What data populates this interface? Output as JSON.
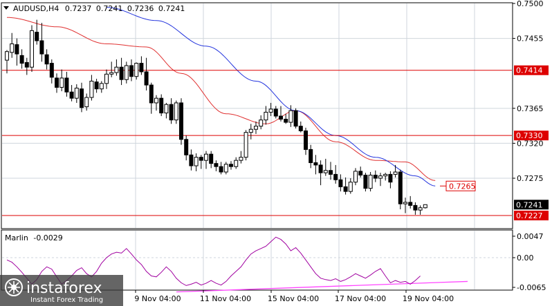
{
  "header": {
    "symbol": "AUDUSD,H4",
    "open": "0.7237",
    "high": "0.7241",
    "low": "0.7236",
    "close": "0.7241"
  },
  "indicator": {
    "name": "Marlin",
    "value": "-0.0029",
    "axis_labels": [
      "0.0047",
      "0.00",
      "-0.0065"
    ]
  },
  "watermark": {
    "brand": "instaforex",
    "tagline": "Instant Forex Trading"
  },
  "colors": {
    "candle": "#000000",
    "ma_red": "#e03030",
    "ma_blue": "#2233dd",
    "level": "#dd0000",
    "oscillator": "#a000a0",
    "trendline": "#ff44ff",
    "grid": "#cfd6dc"
  },
  "chart_data": {
    "type": "candlestick",
    "y_range": [
      0.7213,
      0.75
    ],
    "price_ticks": [
      "0.7500",
      "0.7455",
      "0.7414",
      "0.7365",
      "0.7330",
      "0.7320",
      "0.7275",
      "0.7265",
      "0.7241",
      "0.7227"
    ],
    "x_ticks": [
      "9 Nov 04:00",
      "11 Nov 04:00",
      "15 Nov 04:00",
      "17 Nov 04:00",
      "19 Nov 04:00"
    ],
    "levels": [
      {
        "label": "0.7414",
        "value": 0.7414
      },
      {
        "label": "0.7330",
        "value": 0.733
      },
      {
        "label": "0.7227",
        "value": 0.7227
      }
    ],
    "ma_tag": {
      "label": "0.7265",
      "value": 0.7265
    },
    "last_price": {
      "label": "0.7241",
      "value": 0.7241
    },
    "candles": [
      [
        0.7427,
        0.744,
        0.741,
        0.7438
      ],
      [
        0.7437,
        0.7462,
        0.743,
        0.7448
      ],
      [
        0.7447,
        0.7455,
        0.742,
        0.7435
      ],
      [
        0.7433,
        0.7441,
        0.7416,
        0.7423
      ],
      [
        0.7424,
        0.743,
        0.7408,
        0.7418
      ],
      [
        0.7418,
        0.7472,
        0.7412,
        0.7465
      ],
      [
        0.7463,
        0.7479,
        0.7447,
        0.7452
      ],
      [
        0.7452,
        0.7475,
        0.7425,
        0.7435
      ],
      [
        0.7434,
        0.7441,
        0.7415,
        0.7422
      ],
      [
        0.7423,
        0.7428,
        0.7397,
        0.7405
      ],
      [
        0.7404,
        0.741,
        0.7385,
        0.7392
      ],
      [
        0.7392,
        0.7415,
        0.7387,
        0.7404
      ],
      [
        0.7404,
        0.7412,
        0.738,
        0.7386
      ],
      [
        0.7386,
        0.7395,
        0.7374,
        0.7378
      ],
      [
        0.7378,
        0.7396,
        0.7372,
        0.7391
      ],
      [
        0.739,
        0.7398,
        0.736,
        0.7366
      ],
      [
        0.7367,
        0.7384,
        0.7362,
        0.7379
      ],
      [
        0.7379,
        0.7408,
        0.7375,
        0.74
      ],
      [
        0.7399,
        0.7403,
        0.7385,
        0.739
      ],
      [
        0.739,
        0.74,
        0.7385,
        0.7397
      ],
      [
        0.7397,
        0.7415,
        0.739,
        0.7409
      ],
      [
        0.7409,
        0.7425,
        0.7405,
        0.7411
      ],
      [
        0.7411,
        0.7428,
        0.7407,
        0.7418
      ],
      [
        0.7418,
        0.743,
        0.7395,
        0.7402
      ],
      [
        0.7402,
        0.7425,
        0.7397,
        0.742
      ],
      [
        0.742,
        0.7428,
        0.74,
        0.7406
      ],
      [
        0.7406,
        0.7424,
        0.7402,
        0.7423
      ],
      [
        0.7423,
        0.7432,
        0.7408,
        0.7412
      ],
      [
        0.7412,
        0.743,
        0.7388,
        0.7395
      ],
      [
        0.7395,
        0.7398,
        0.7358,
        0.7372
      ],
      [
        0.7372,
        0.7382,
        0.7362,
        0.7378
      ],
      [
        0.7378,
        0.7383,
        0.7355,
        0.7359
      ],
      [
        0.7359,
        0.7372,
        0.7352,
        0.737
      ],
      [
        0.737,
        0.7378,
        0.7345,
        0.735
      ],
      [
        0.735,
        0.7375,
        0.7345,
        0.7372
      ],
      [
        0.7372,
        0.7378,
        0.7318,
        0.7325
      ],
      [
        0.7325,
        0.733,
        0.7298,
        0.7305
      ],
      [
        0.7305,
        0.7312,
        0.7285,
        0.7291
      ],
      [
        0.7291,
        0.7307,
        0.7284,
        0.7302
      ],
      [
        0.7302,
        0.7305,
        0.7287,
        0.7298
      ],
      [
        0.7298,
        0.731,
        0.7287,
        0.7306
      ],
      [
        0.7306,
        0.731,
        0.7288,
        0.7294
      ],
      [
        0.7294,
        0.7298,
        0.7284,
        0.729
      ],
      [
        0.729,
        0.7296,
        0.728,
        0.7283
      ],
      [
        0.7283,
        0.7296,
        0.728,
        0.7293
      ],
      [
        0.7293,
        0.7297,
        0.7286,
        0.729
      ],
      [
        0.729,
        0.7302,
        0.7287,
        0.7298
      ],
      [
        0.7298,
        0.731,
        0.7294,
        0.7302
      ],
      [
        0.7302,
        0.7337,
        0.7298,
        0.7334
      ],
      [
        0.7334,
        0.7345,
        0.7325,
        0.7338
      ],
      [
        0.7338,
        0.7348,
        0.7332,
        0.7342
      ],
      [
        0.7342,
        0.7356,
        0.7338,
        0.735
      ],
      [
        0.735,
        0.7368,
        0.7344,
        0.736
      ],
      [
        0.736,
        0.7372,
        0.7355,
        0.7364
      ],
      [
        0.7364,
        0.7368,
        0.7352,
        0.7355
      ],
      [
        0.7355,
        0.7368,
        0.7348,
        0.7351
      ],
      [
        0.7351,
        0.7358,
        0.7345,
        0.7347
      ],
      [
        0.7347,
        0.7369,
        0.7341,
        0.7362
      ],
      [
        0.7362,
        0.7365,
        0.7339,
        0.7342
      ],
      [
        0.7342,
        0.7348,
        0.7334,
        0.7336
      ],
      [
        0.7336,
        0.734,
        0.7305,
        0.7312
      ],
      [
        0.7312,
        0.7318,
        0.7288,
        0.7295
      ],
      [
        0.7295,
        0.7305,
        0.728,
        0.7292
      ],
      [
        0.7292,
        0.7298,
        0.7266,
        0.7282
      ],
      [
        0.7282,
        0.73,
        0.7278,
        0.7285
      ],
      [
        0.7285,
        0.7296,
        0.7273,
        0.728
      ],
      [
        0.728,
        0.7292,
        0.7268,
        0.7273
      ],
      [
        0.7273,
        0.728,
        0.7258,
        0.7264
      ],
      [
        0.7264,
        0.7276,
        0.7254,
        0.7258
      ],
      [
        0.7258,
        0.7275,
        0.7255,
        0.727
      ],
      [
        0.727,
        0.7288,
        0.7266,
        0.7284
      ],
      [
        0.7284,
        0.729,
        0.7276,
        0.7279
      ],
      [
        0.7279,
        0.7282,
        0.7258,
        0.7262
      ],
      [
        0.7262,
        0.7283,
        0.7258,
        0.7279
      ],
      [
        0.7279,
        0.7285,
        0.727,
        0.7275
      ],
      [
        0.7275,
        0.7282,
        0.7265,
        0.7278
      ],
      [
        0.7278,
        0.7282,
        0.7272,
        0.728
      ],
      [
        0.728,
        0.7284,
        0.7262,
        0.727
      ],
      [
        0.728,
        0.7292,
        0.7276,
        0.7283
      ],
      [
        0.7283,
        0.7286,
        0.7235,
        0.7242
      ],
      [
        0.7242,
        0.725,
        0.723,
        0.7244
      ],
      [
        0.7244,
        0.7252,
        0.7236,
        0.724
      ],
      [
        0.724,
        0.7244,
        0.7228,
        0.7234
      ],
      [
        0.7234,
        0.724,
        0.7228,
        0.7237
      ],
      [
        0.7237,
        0.7241,
        0.7236,
        0.7241
      ]
    ],
    "marlin": [
      -0.0005,
      -0.001,
      -0.002,
      -0.0032,
      -0.0045,
      -0.0058,
      -0.0048,
      -0.003,
      -0.002,
      -0.0025,
      -0.0042,
      -0.0058,
      -0.005,
      -0.004,
      -0.0028,
      -0.0022,
      -0.0035,
      -0.0042,
      -0.003,
      -0.0012,
      0.0,
      0.0008,
      0.0012,
      0.001,
      0.002,
      0.0008,
      -0.0005,
      -0.0015,
      -0.003,
      -0.004,
      -0.0042,
      -0.0032,
      -0.002,
      -0.003,
      -0.0045,
      -0.0055,
      -0.0061,
      -0.0058,
      -0.0054,
      -0.006,
      -0.0056,
      -0.005,
      -0.0056,
      -0.006,
      -0.0052,
      -0.004,
      -0.003,
      -0.002,
      -0.0005,
      0.0008,
      0.0015,
      0.002,
      0.0025,
      0.0035,
      0.0045,
      0.004,
      0.003,
      0.0015,
      0.0022,
      0.001,
      -0.0005,
      -0.002,
      -0.0035,
      -0.0045,
      -0.0048,
      -0.005,
      -0.0046,
      -0.0052,
      -0.0048,
      -0.0042,
      -0.0035,
      -0.004,
      -0.0045,
      -0.0038,
      -0.003,
      -0.0024,
      -0.004,
      -0.0055,
      -0.005,
      -0.0054,
      -0.0052,
      -0.0058,
      -0.005,
      -0.004
    ],
    "marlin_range": [
      -0.0068,
      0.0056
    ],
    "marlin_zero": 0.0,
    "marlin_trendline": [
      [
        -0.0075,
        0
      ],
      [
        -0.0052,
        84
      ]
    ],
    "ma_red_anchors": [
      [
        0,
        0.7482
      ],
      [
        10,
        0.747
      ],
      [
        20,
        0.7448
      ],
      [
        28,
        0.7444
      ],
      [
        35,
        0.741
      ],
      [
        44,
        0.7358
      ],
      [
        52,
        0.7345
      ],
      [
        58,
        0.7362
      ],
      [
        66,
        0.7322
      ],
      [
        74,
        0.7298
      ],
      [
        80,
        0.7296
      ],
      [
        86,
        0.7272
      ]
    ],
    "ma_blue_anchors": [
      [
        20,
        0.7495
      ],
      [
        30,
        0.7478
      ],
      [
        40,
        0.7445
      ],
      [
        50,
        0.74
      ],
      [
        58,
        0.7362
      ],
      [
        66,
        0.733
      ],
      [
        74,
        0.7302
      ],
      [
        82,
        0.7278
      ],
      [
        86,
        0.7265
      ]
    ]
  }
}
